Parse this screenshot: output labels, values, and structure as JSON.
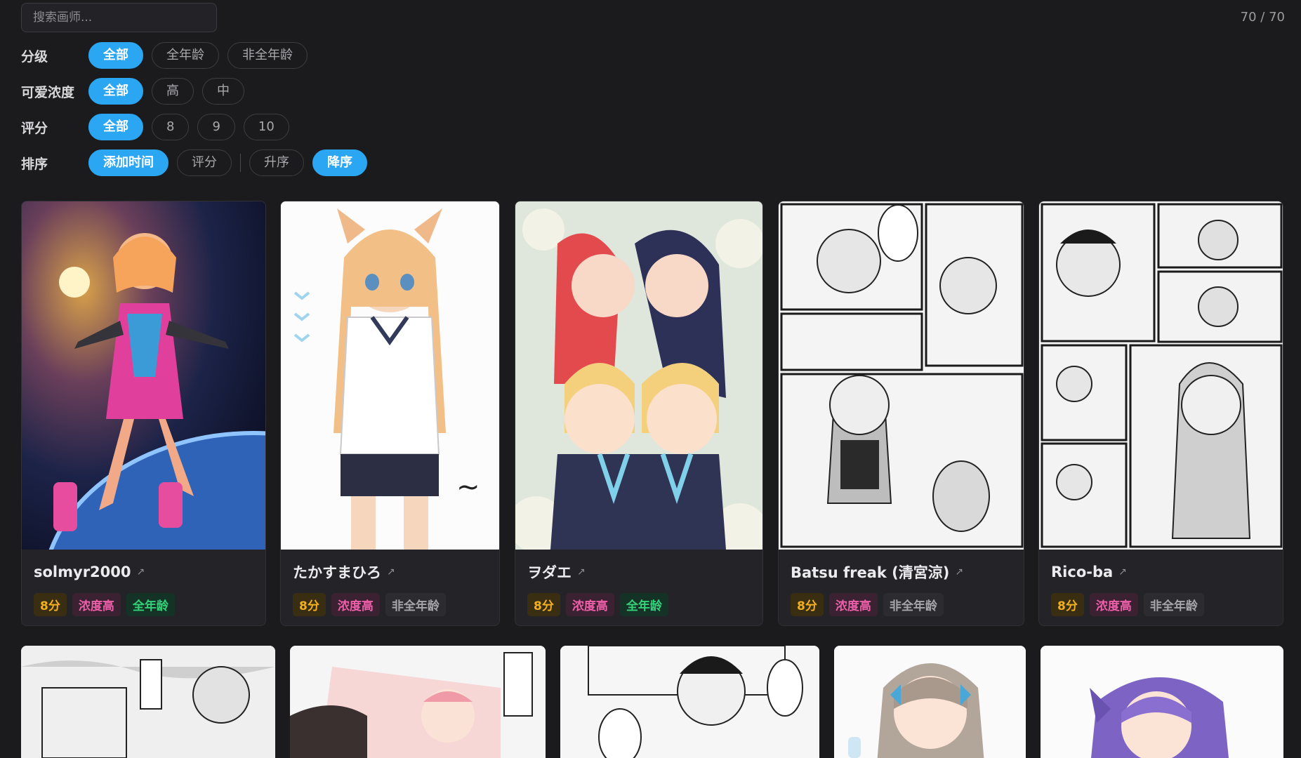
{
  "search": {
    "placeholder": "搜索画师..."
  },
  "count": "70 / 70",
  "filters": {
    "rating": {
      "label": "分级",
      "options": [
        "全部",
        "全年龄",
        "非全年龄"
      ]
    },
    "cuteness": {
      "label": "可爱浓度",
      "options": [
        "全部",
        "高",
        "中"
      ]
    },
    "score": {
      "label": "评分",
      "options": [
        "全部",
        "8",
        "9",
        "10"
      ]
    },
    "sort": {
      "label": "排序",
      "options": [
        "添加时间",
        "评分"
      ],
      "order": [
        "升序",
        "降序"
      ]
    }
  },
  "cards": [
    {
      "name": "solmyr2000",
      "score": "8分",
      "density": "浓度高",
      "rating": "全年龄"
    },
    {
      "name": "たかすまひろ",
      "score": "8分",
      "density": "浓度高",
      "rating": "非全年龄"
    },
    {
      "name": "ヲダエ",
      "score": "8分",
      "density": "浓度高",
      "rating": "全年龄"
    },
    {
      "name": "Batsu freak (清宮涼)",
      "score": "8分",
      "density": "浓度高",
      "rating": "非全年龄"
    },
    {
      "name": "Rico-ba",
      "score": "8分",
      "density": "浓度高",
      "rating": "非全年龄"
    }
  ],
  "icons": {
    "external": "arrow-up-right-icon"
  },
  "colors": {
    "accent": "#2aa6f2",
    "score": "#f2b021",
    "density": "#ee5fa9",
    "all_ages": "#33d17a"
  }
}
